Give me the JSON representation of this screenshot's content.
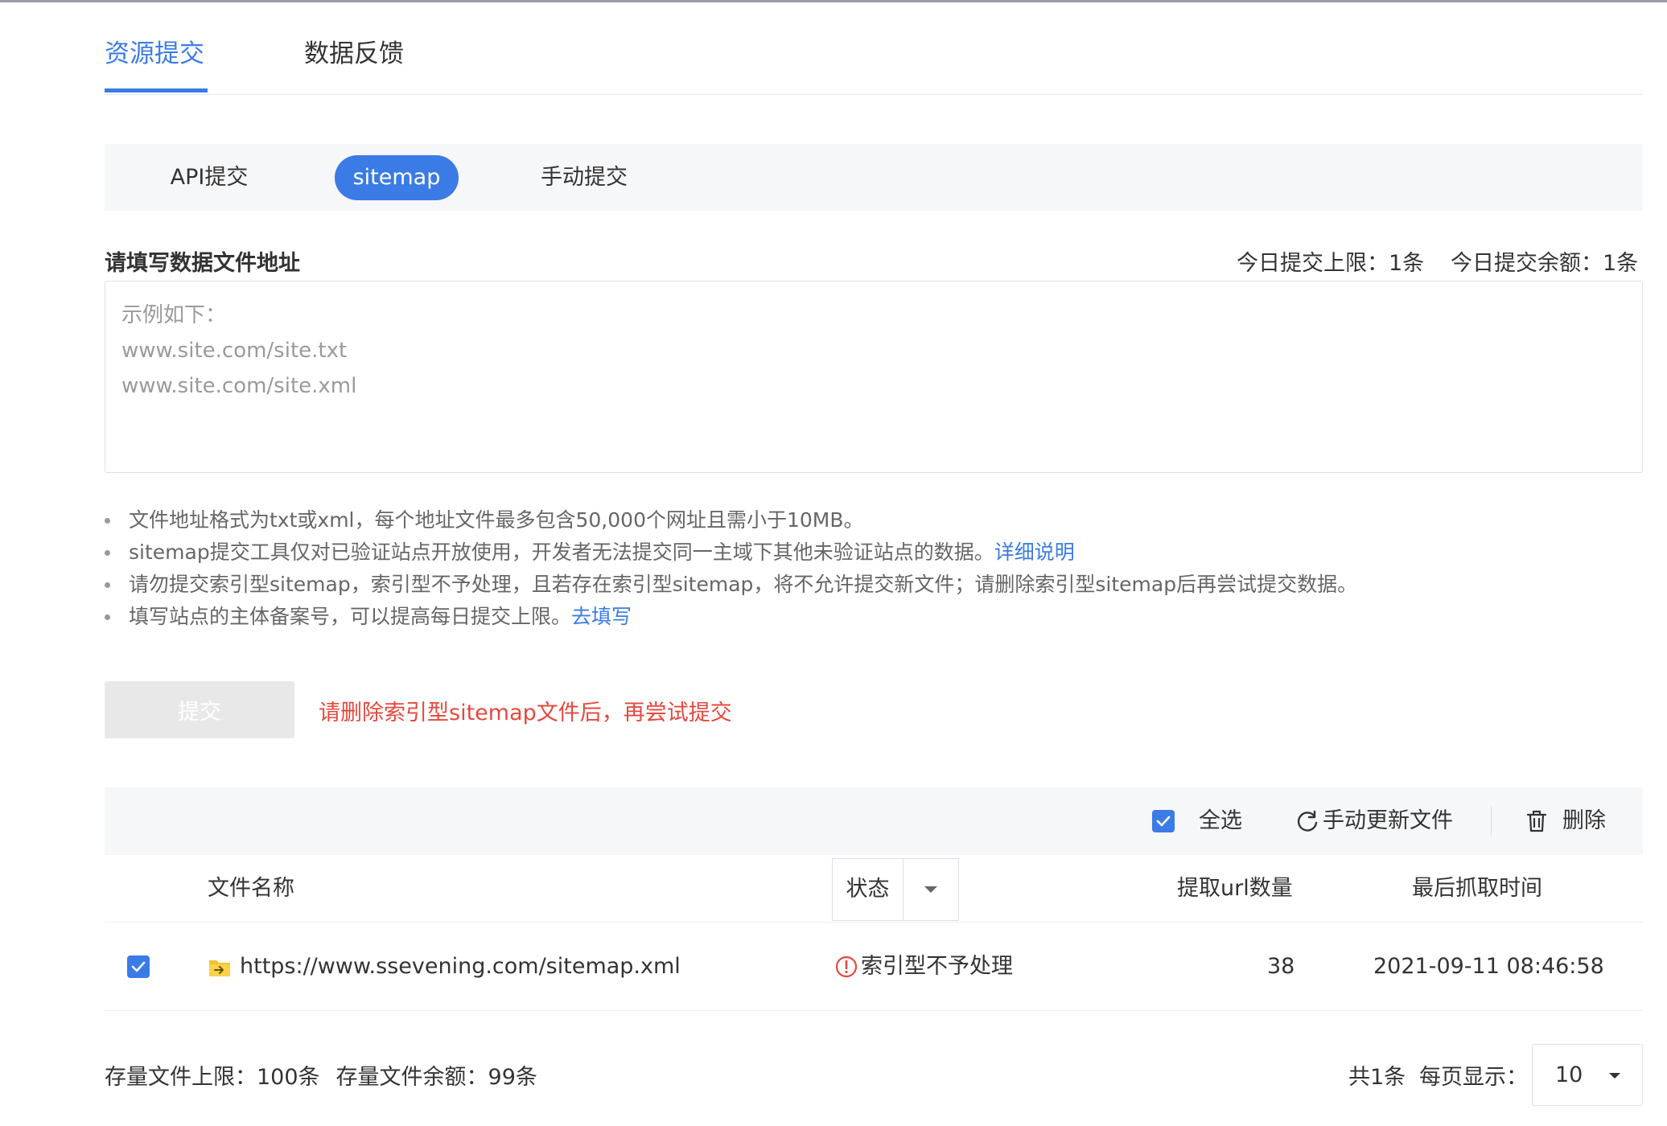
{
  "tabs": [
    {
      "label": "资源提交",
      "active": true
    },
    {
      "label": "数据反馈",
      "active": false
    }
  ],
  "sub_tabs": [
    {
      "label": "API提交",
      "active": false
    },
    {
      "label": "sitemap",
      "active": true
    },
    {
      "label": "手动提交",
      "active": false
    }
  ],
  "form": {
    "label": "请填写数据文件地址",
    "quota_limit": "今日提交上限：1条",
    "quota_remaining": "今日提交余额：1条",
    "textarea_value": "",
    "textarea_placeholder": "示例如下：\nwww.site.com/site.txt\nwww.site.com/site.xml"
  },
  "notes": [
    {
      "text": "文件地址格式为txt或xml，每个地址文件最多包含50,000个网址且需小于10MB。",
      "link": ""
    },
    {
      "text": "sitemap提交工具仅对已验证站点开放使用，开发者无法提交同一主域下其他未验证站点的数据。",
      "link": "详细说明"
    },
    {
      "text": "请勿提交索引型sitemap，索引型不予处理，且若存在索引型sitemap，将不允许提交新文件；请删除索引型sitemap后再尝试提交数据。",
      "link": ""
    },
    {
      "text": "填写站点的主体备案号，可以提高每日提交上限。",
      "link": "去填写"
    }
  ],
  "submit": {
    "label": "提交",
    "error": "请删除索引型sitemap文件后，再尝试提交"
  },
  "toolbar": {
    "select_all": "全选",
    "refresh": "手动更新文件",
    "delete": "删除"
  },
  "table": {
    "columns": {
      "name": "文件名称",
      "status": "状态",
      "url_count": "提取url数量",
      "last_crawl": "最后抓取时间"
    },
    "rows": [
      {
        "checked": true,
        "name": "https://www.ssevening.com/sitemap.xml",
        "status": "索引型不予处理",
        "url_count": "38",
        "last_crawl": "2021-09-11 08:46:58"
      }
    ]
  },
  "footer": {
    "storage_limit": "存量文件上限：100条",
    "storage_remaining": "存量文件余额：99条",
    "total": "共1条",
    "per_page_label": "每页显示：",
    "per_page_value": "10"
  },
  "colors": {
    "accent": "#3b7be5",
    "error": "#e5483d",
    "panel_bg": "#f6f7f9",
    "text": "#333333",
    "muted": "#666666"
  },
  "icons": {
    "toolbar_refresh": "refresh-icon",
    "toolbar_delete": "trash-icon",
    "file": "folder-file-icon",
    "status": "warning-circle-icon",
    "dropdown": "caret-down-icon"
  }
}
